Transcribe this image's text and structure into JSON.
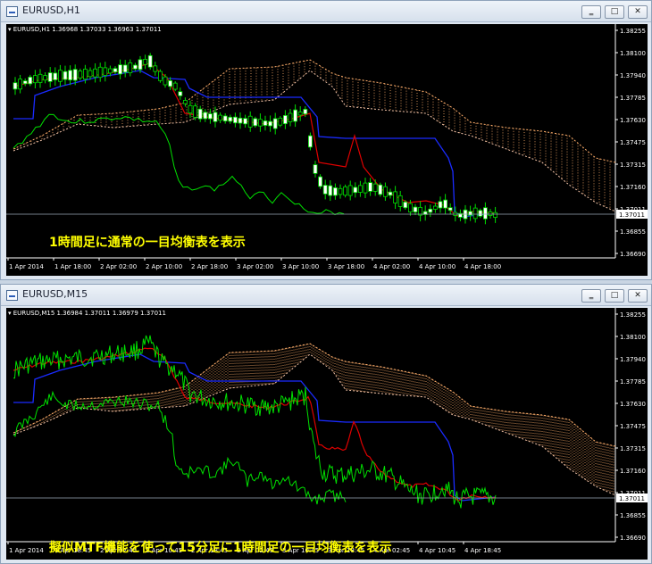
{
  "windows": [
    {
      "title": "EURUSD,H1",
      "info": "▾ EURUSD,H1  1.36968 1.37033 1.36963 1.37011",
      "note": "1時間足に通常の一目均衡表を表示",
      "price_labels": [
        "1.38255",
        "1.38100",
        "1.37940",
        "1.37785",
        "1.37630",
        "1.37475",
        "1.37315",
        "1.37160",
        "1.37011",
        "1.36855",
        "1.36690"
      ],
      "current_price": "1.37011",
      "time_labels": [
        "1 Apr 2014",
        "1 Apr 18:00",
        "2 Apr 02:00",
        "2 Apr 10:00",
        "2 Apr 18:00",
        "3 Apr 02:00",
        "3 Apr 10:00",
        "3 Apr 18:00",
        "4 Apr 02:00",
        "4 Apr 10:00",
        "4 Apr 18:00"
      ]
    },
    {
      "title": "EURUSD,M15",
      "info": "▾ EURUSD,M15  1.36984 1.37011 1.36979 1.37011",
      "note": "擬似MTF機能を使って15分足に1時間足の一目均衡表を表示",
      "price_labels": [
        "1.38255",
        "1.38100",
        "1.37940",
        "1.37785",
        "1.37630",
        "1.37475",
        "1.37315",
        "1.37160",
        "1.37011",
        "1.36855",
        "1.36690"
      ],
      "current_price": "1.37011",
      "time_labels": [
        "1 Apr 2014",
        "1 Apr 18:45",
        "2 Apr 02:45",
        "2 Apr 10:45",
        "2 Apr 18:45",
        "3 Apr 02:45",
        "3 Apr 10:45",
        "3 Apr 18:45",
        "4 Apr 02:45",
        "4 Apr 10:45",
        "4 Apr 18:45"
      ]
    }
  ],
  "buttons": {
    "minimize": "‗",
    "maximize": "□",
    "close": "✕"
  },
  "colors": {
    "tenkan": "#e00000",
    "kijun": "#1a2bff",
    "chikou": "#00e000",
    "candle": "#ffffff",
    "cloud": "#ffae6b"
  }
}
